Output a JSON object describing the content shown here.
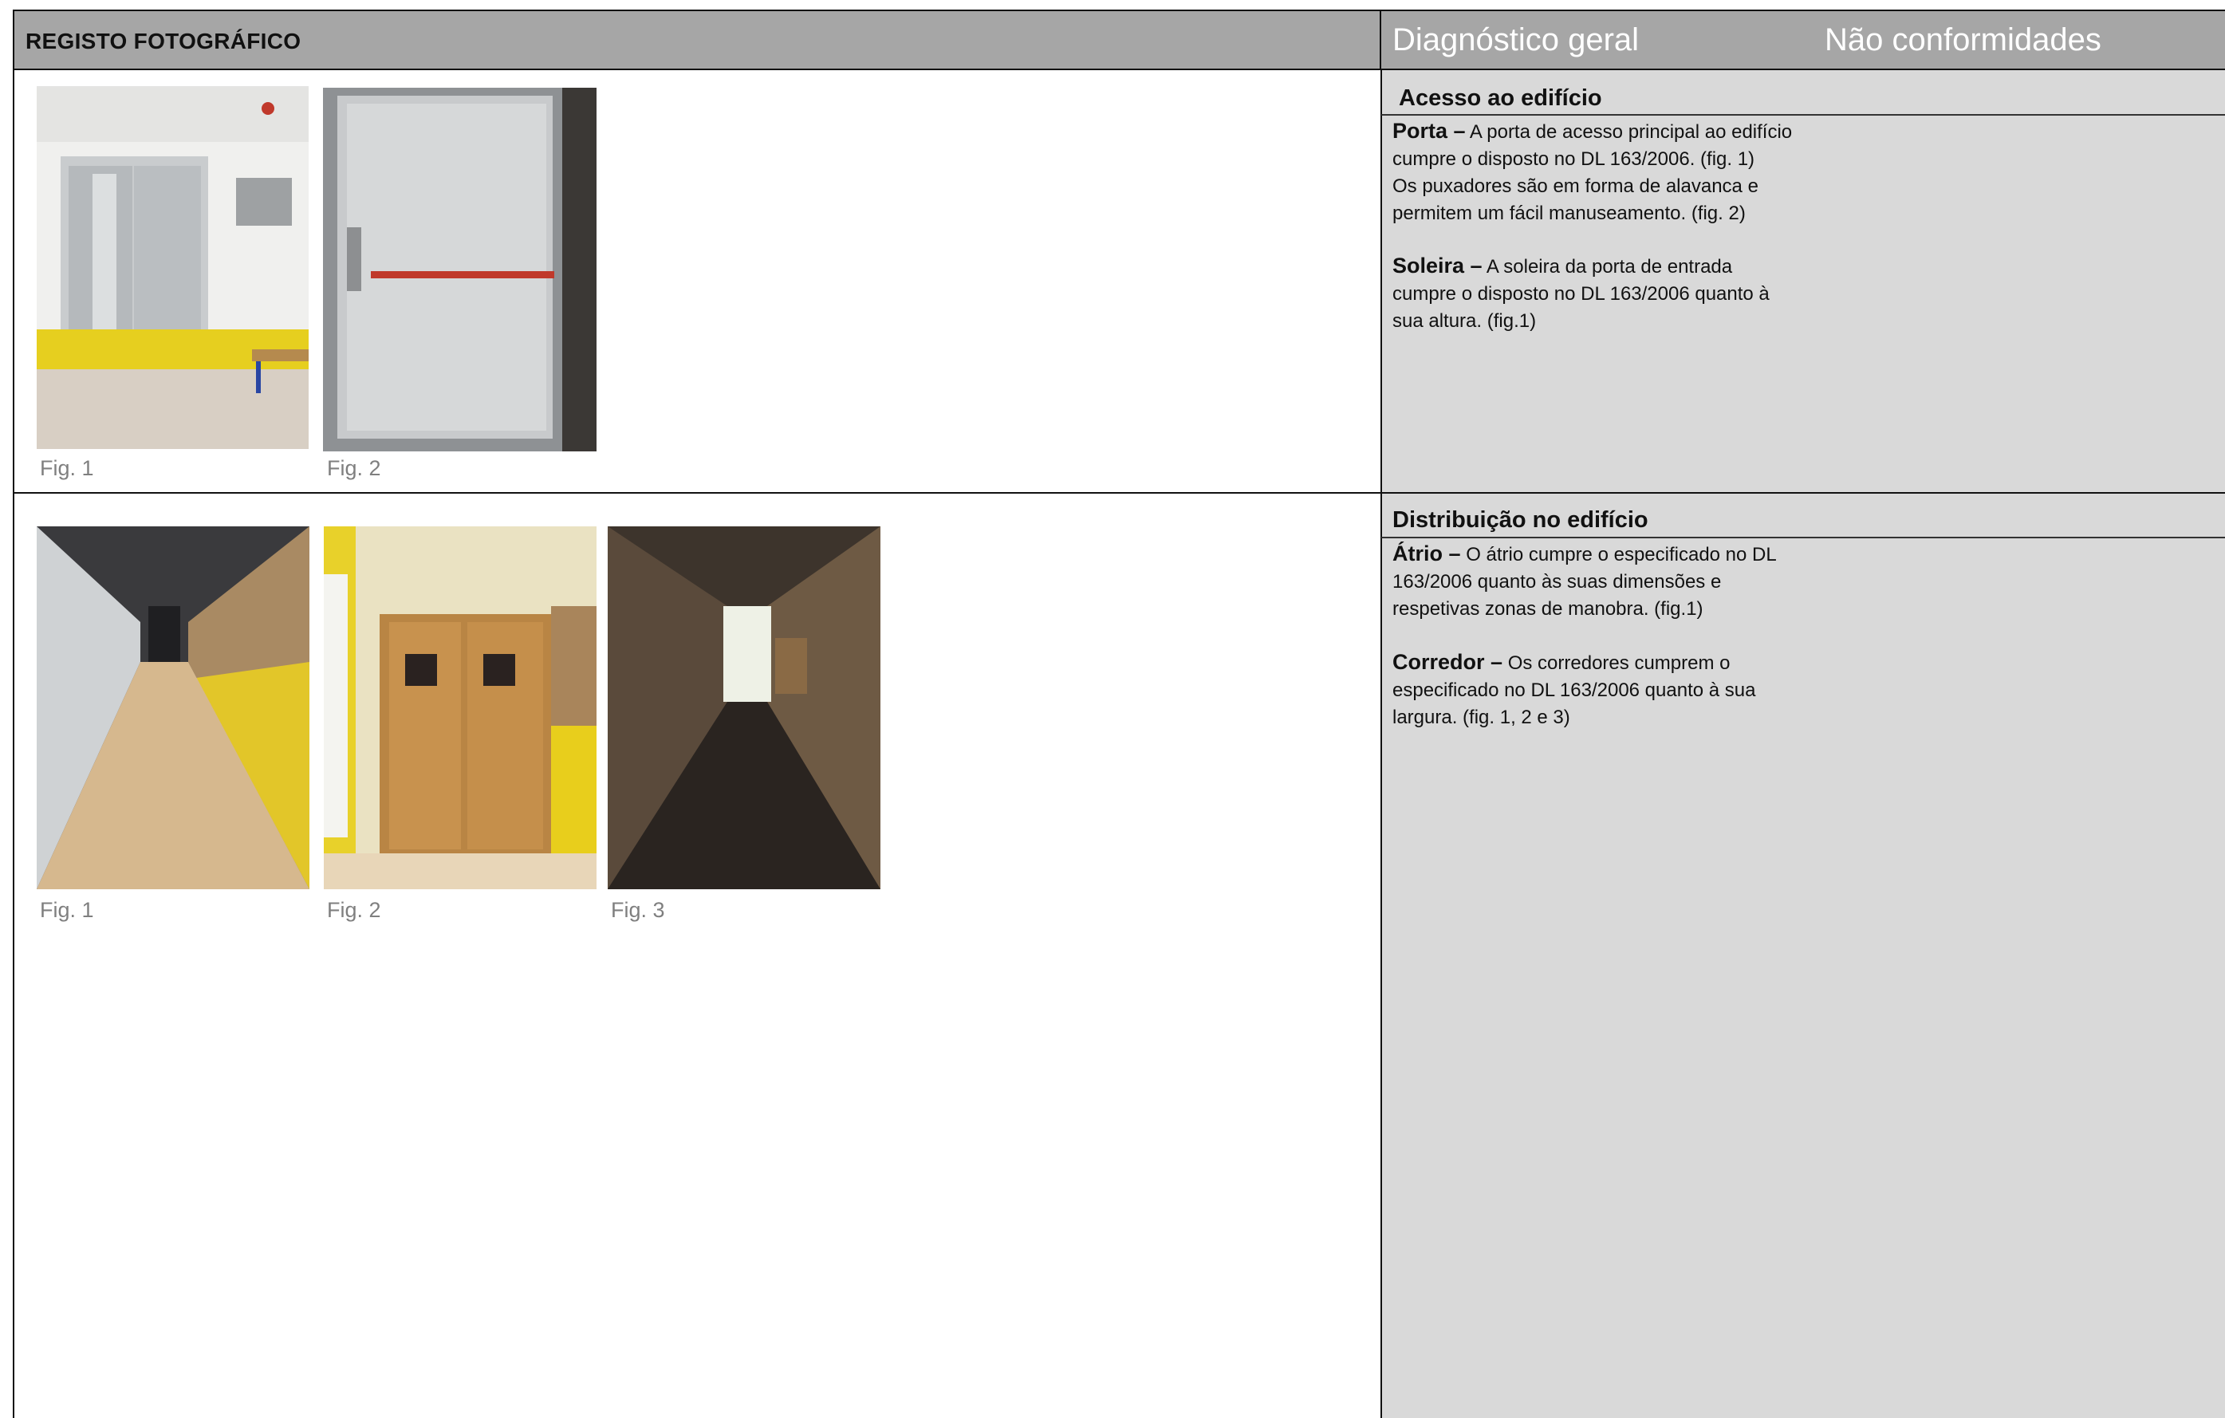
{
  "header": {
    "left_title": "REGISTO FOTOGRÁFICO",
    "right_col1": "Diagnóstico geral",
    "right_col2": "Não conformidades"
  },
  "section1": {
    "title": "Acesso ao edifício",
    "figures": [
      "Fig. 1",
      "Fig. 2"
    ],
    "paragraphs": [
      {
        "label": "Porta –",
        "lines": [
          "A porta de acesso principal ao edifício",
          "cumpre o disposto no DL 163/2006. (fig. 1)",
          "Os puxadores são em forma de alavanca e",
          "permitem um fácil manuseamento. (fig. 2)"
        ]
      },
      {
        "label": "Soleira –",
        "lines": [
          "A soleira da porta de entrada",
          "cumpre o disposto no DL 163/2006 quanto à",
          "sua altura. (fig.1)"
        ]
      }
    ]
  },
  "section2": {
    "title": "Distribuição no edifício",
    "figures": [
      "Fig. 1",
      "Fig. 2",
      "Fig. 3"
    ],
    "paragraphs": [
      {
        "label": "Átrio –",
        "lines": [
          "O átrio cumpre o especificado no DL",
          "163/2006 quanto às suas dimensões e",
          "respetivas zonas de manobra. (fig.1)"
        ]
      },
      {
        "label": "Corredor –",
        "lines": [
          "Os corredores cumprem o",
          "especificado no DL 163/2006 quanto à sua",
          "largura. (fig. 1, 2 e 3)"
        ]
      }
    ]
  },
  "colors": {
    "header_gray": "#a6a6a6",
    "panel_gray": "#d9d9d9",
    "caption_gray": "#7f7f7f"
  }
}
